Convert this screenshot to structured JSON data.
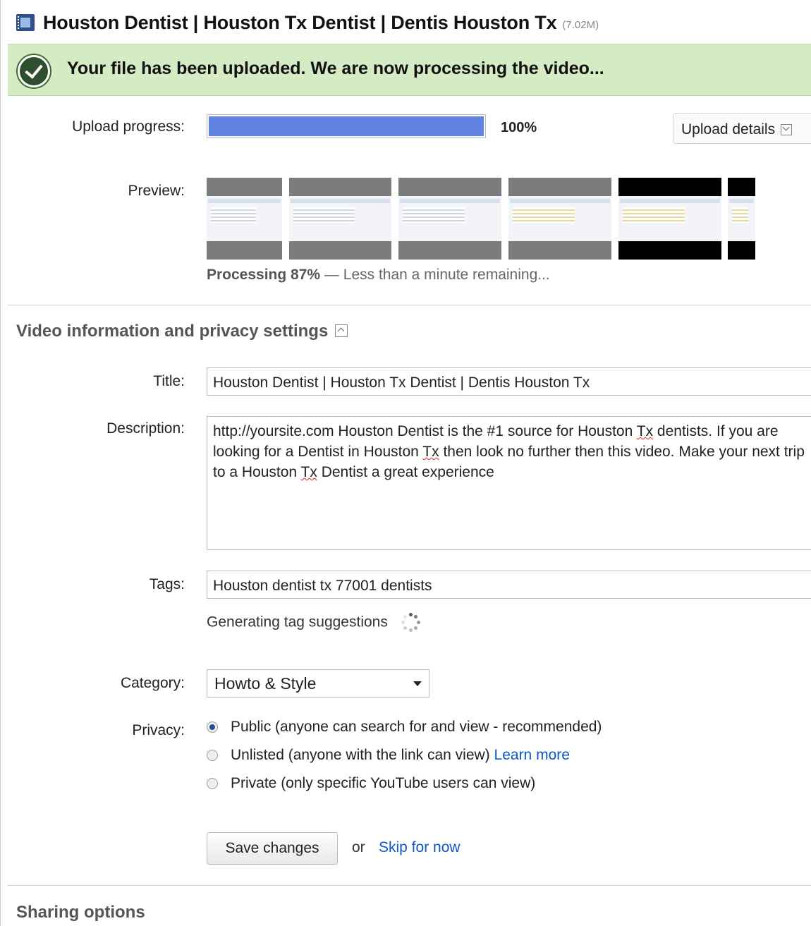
{
  "header": {
    "title": "Houston Dentist | Houston Tx Dentist | Dentis Houston Tx",
    "file_size": "(7.02M)",
    "icon": "film-icon"
  },
  "banner": {
    "message": "Your file has been uploaded. We are now processing the video...",
    "icon": "check-icon",
    "color": "#d4ebc4"
  },
  "upload": {
    "label": "Upload progress:",
    "percent_text": "100%",
    "progress_fraction": 1.0,
    "details_button": "Upload details",
    "bar_color": "#6182e0"
  },
  "preview": {
    "label": "Preview:",
    "processing_status": "Processing 87%",
    "processing_remaining": " — Less than a minute remaining..."
  },
  "video_info": {
    "section_title": "Video information and privacy settings",
    "title_label": "Title:",
    "title_value": "Houston Dentist | Houston Tx Dentist | Dentis Houston Tx",
    "description_label": "Description:",
    "description_value": "http://yoursite.com Houston Dentist is the #1 source for Houston Tx dentists. If you are looking for a Dentist in Houston Tx then look no further then this video. Make your next trip to a Houston Tx Dentist a great experience",
    "tags_label": "Tags:",
    "tags_value": "Houston dentist tx 77001 dentists",
    "tag_suggestions": "Generating tag suggestions",
    "category_label": "Category:",
    "category_value": "Howto & Style",
    "privacy_label": "Privacy:",
    "privacy_options": [
      {
        "label": "Public (anyone can search for and view - recommended)",
        "selected": true
      },
      {
        "label": "Unlisted (anyone with the link can view)",
        "link": "Learn more",
        "selected": false
      },
      {
        "label": "Private (only specific YouTube users can view)",
        "selected": false
      }
    ],
    "save_button": "Save changes",
    "or_text": "or",
    "skip_link": "Skip for now"
  },
  "sharing": {
    "section_title": "Sharing options"
  }
}
